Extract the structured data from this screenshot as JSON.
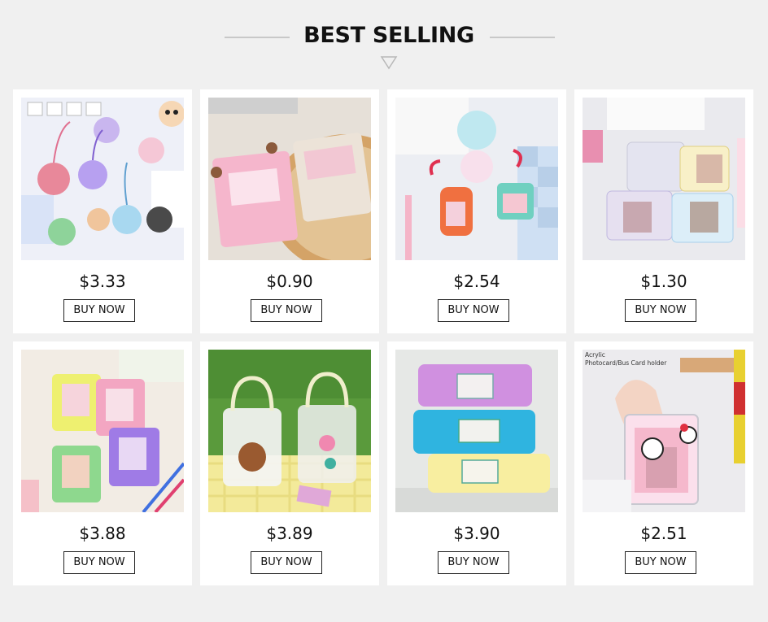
{
  "section": {
    "title": "BEST SELLING"
  },
  "products": [
    {
      "price": "$3.33",
      "button": "BUY NOW"
    },
    {
      "price": "$0.90",
      "button": "BUY NOW"
    },
    {
      "price": "$2.54",
      "button": "BUY NOW"
    },
    {
      "price": "$1.30",
      "button": "BUY NOW"
    },
    {
      "price": "$3.88",
      "button": "BUY NOW"
    },
    {
      "price": "$3.89",
      "button": "BUY NOW"
    },
    {
      "price": "$3.90",
      "button": "BUY NOW"
    },
    {
      "price": "$2.51",
      "button": "BUY NOW",
      "image_text": [
        "Acrylic",
        "Photocard/Bus Card holder"
      ]
    }
  ],
  "icons": {
    "section_arrow": "down-triangle-icon"
  }
}
